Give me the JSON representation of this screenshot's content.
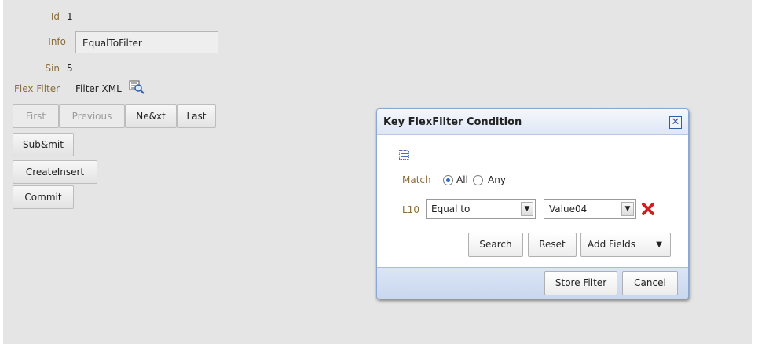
{
  "form": {
    "id_label": "Id",
    "id_value": "1",
    "info_label": "Info",
    "info_value": "EqualToFilter",
    "sin_label": "Sin",
    "sin_value": "5",
    "flex_label": "Flex Filter",
    "flex_value": "Filter XML"
  },
  "nav": {
    "first": "First",
    "previous": "Previous",
    "next": "Ne&xt",
    "last": "Last",
    "submit": "Sub&mit",
    "create_insert": "CreateInsert",
    "commit": "Commit"
  },
  "dialog": {
    "title": "Key FlexFilter Condition",
    "close": "✕",
    "match_label": "Match",
    "match_options": [
      "All",
      "Any"
    ],
    "match_selected": "All",
    "field_label": "L10",
    "operator_value": "Equal to",
    "value_value": "Value04",
    "search": "Search",
    "reset": "Reset",
    "add_fields": "Add Fields",
    "store_filter": "Store Filter",
    "cancel": "Cancel"
  },
  "colors": {
    "label": "#8a6d3b",
    "dialog_border": "#8aa7d6",
    "footer": "#c9d7ef",
    "delete": "#d11f1f"
  },
  "icons": [
    "filter-xml-icon",
    "grid-icon",
    "delete-icon",
    "dropdown-arrow-icon",
    "close-icon"
  ]
}
